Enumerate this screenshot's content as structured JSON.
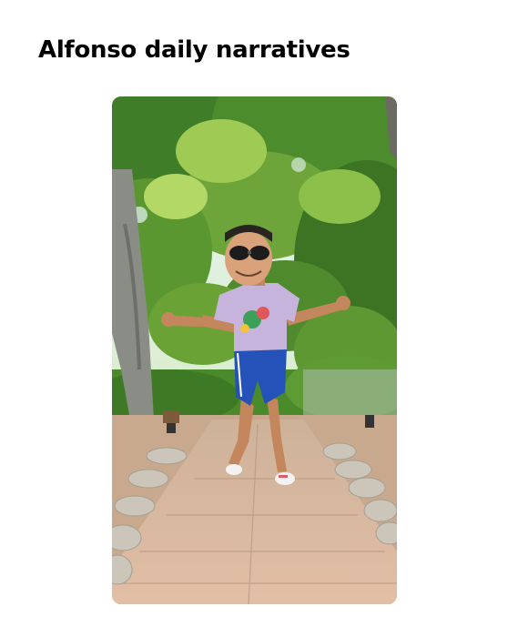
{
  "header": {
    "title": "Alfonso daily narratives"
  },
  "video": {
    "colors": {
      "foliage_dark": "#2f6b22",
      "foliage_mid": "#5f9e33",
      "foliage_light": "#a7cf55",
      "sky": "#dff1f6",
      "path": "#d9b79c",
      "rocks": "#c7c2b6",
      "shirt": "#c6b4dd",
      "shorts": "#2552b8",
      "skin": "#c4865c"
    }
  }
}
